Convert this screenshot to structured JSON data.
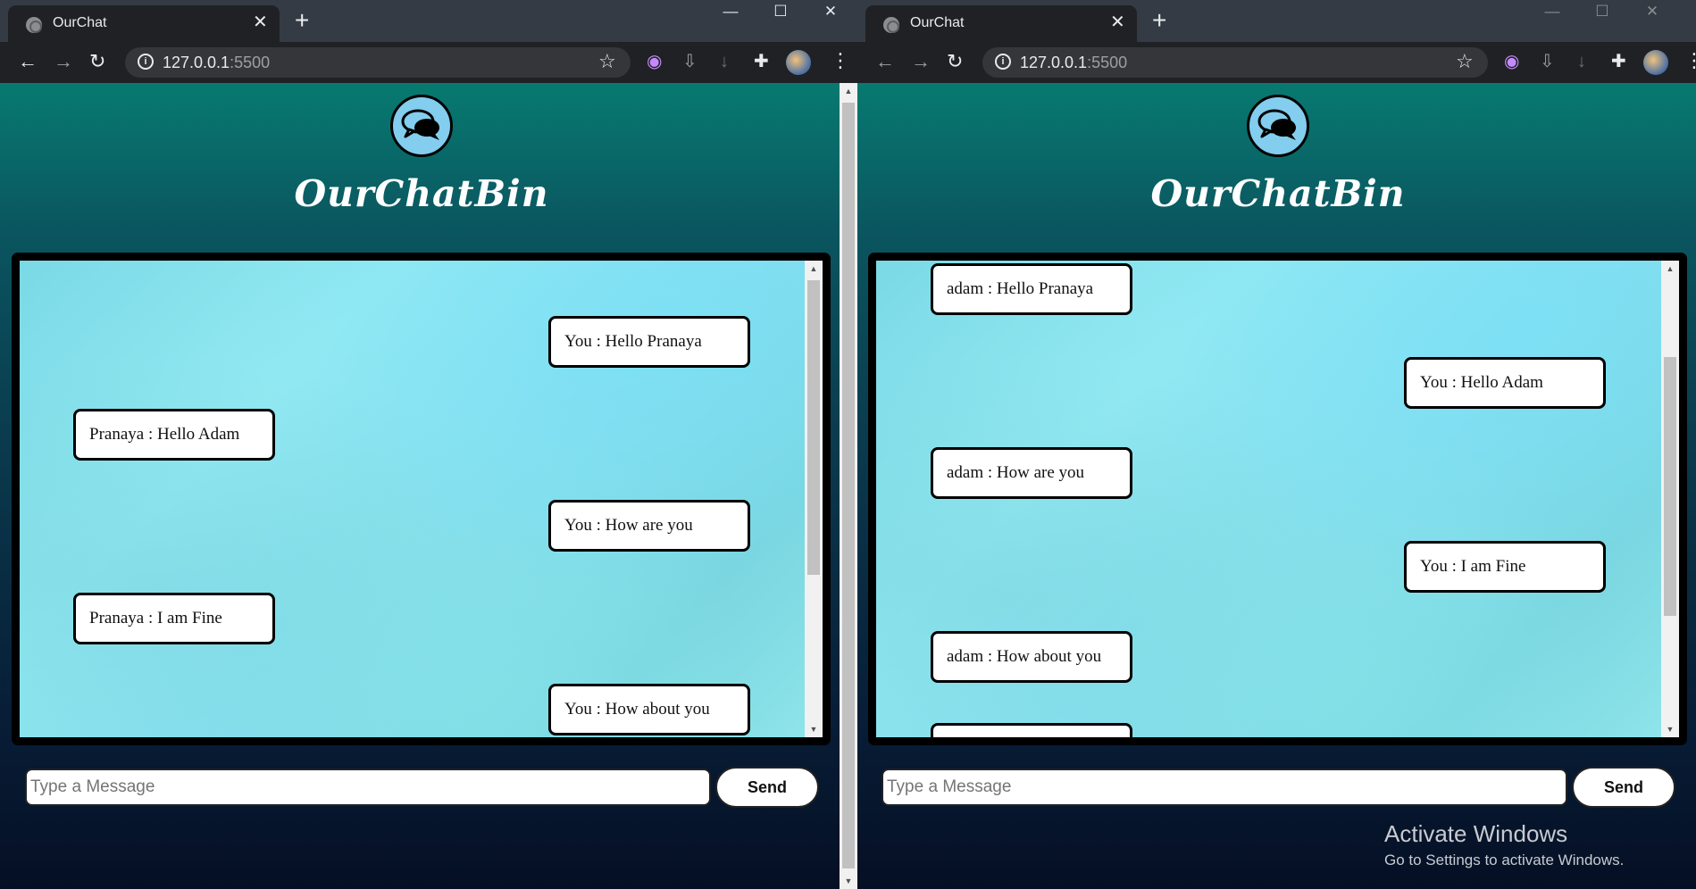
{
  "windows": [
    {
      "tab_title": "OurChat",
      "tab_close": "✕",
      "new_tab": "+",
      "controls": {
        "minimize": "—",
        "maximize": "☐",
        "close": "✕"
      },
      "url_host": "127.0.0.1",
      "url_port": ":5500",
      "brand": "OurChatBin",
      "messages": [
        {
          "text": "You : Hello Pranaya",
          "side": "right"
        },
        {
          "text": "Pranaya : Hello Adam",
          "side": "left"
        },
        {
          "text": "You : How are you",
          "side": "right"
        },
        {
          "text": "Pranaya : I am Fine",
          "side": "left"
        },
        {
          "text": "You : How about you",
          "side": "right"
        }
      ],
      "input_placeholder": "Type a Message",
      "send_label": "Send"
    },
    {
      "tab_title": "OurChat",
      "tab_close": "✕",
      "new_tab": "+",
      "controls": {
        "minimize": "—",
        "maximize": "☐",
        "close": "✕"
      },
      "url_host": "127.0.0.1",
      "url_port": ":5500",
      "brand": "OurChatBin",
      "messages": [
        {
          "text": "adam : Hello Pranaya",
          "side": "left"
        },
        {
          "text": "You : Hello Adam",
          "side": "right"
        },
        {
          "text": "adam : How are you",
          "side": "left"
        },
        {
          "text": "You : I am Fine",
          "side": "right"
        },
        {
          "text": "adam : How about you",
          "side": "left"
        },
        {
          "text": "",
          "side": "left"
        }
      ],
      "input_placeholder": "Type a Message",
      "send_label": "Send"
    }
  ],
  "watermark": {
    "title": "Activate Windows",
    "subtitle": "Go to Settings to activate Windows."
  },
  "colors": {
    "page_top": "#087a70",
    "page_bottom": "#050f24",
    "logo_fill": "#83cdee",
    "chat_bg": "#8fe5ea",
    "chrome_dark": "#202124"
  },
  "icons": [
    "globe-favicon",
    "back-arrow-icon",
    "forward-arrow-icon",
    "reload-icon",
    "info-icon",
    "star-icon",
    "extension-icon",
    "puzzle-icon",
    "profile-avatar",
    "menu-kebab-icon",
    "chat-bubbles-icon"
  ]
}
